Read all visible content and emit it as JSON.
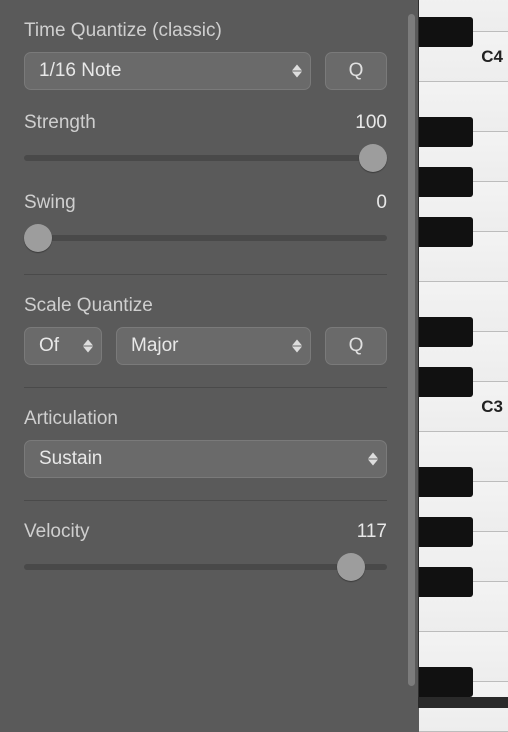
{
  "timeQuantize": {
    "title": "Time Quantize (classic)",
    "value": "1/16 Note",
    "qLabel": "Q"
  },
  "strength": {
    "label": "Strength",
    "value": "100",
    "percent": 100
  },
  "swing": {
    "label": "Swing",
    "value": "0",
    "percent": 0
  },
  "scaleQuantize": {
    "title": "Scale Quantize",
    "root": "Of",
    "scale": "Major",
    "qLabel": "Q"
  },
  "articulation": {
    "title": "Articulation",
    "value": "Sustain"
  },
  "velocity": {
    "label": "Velocity",
    "value": "117",
    "percent": 92
  },
  "piano": {
    "labelTop": "C4",
    "labelMid": "C3"
  }
}
